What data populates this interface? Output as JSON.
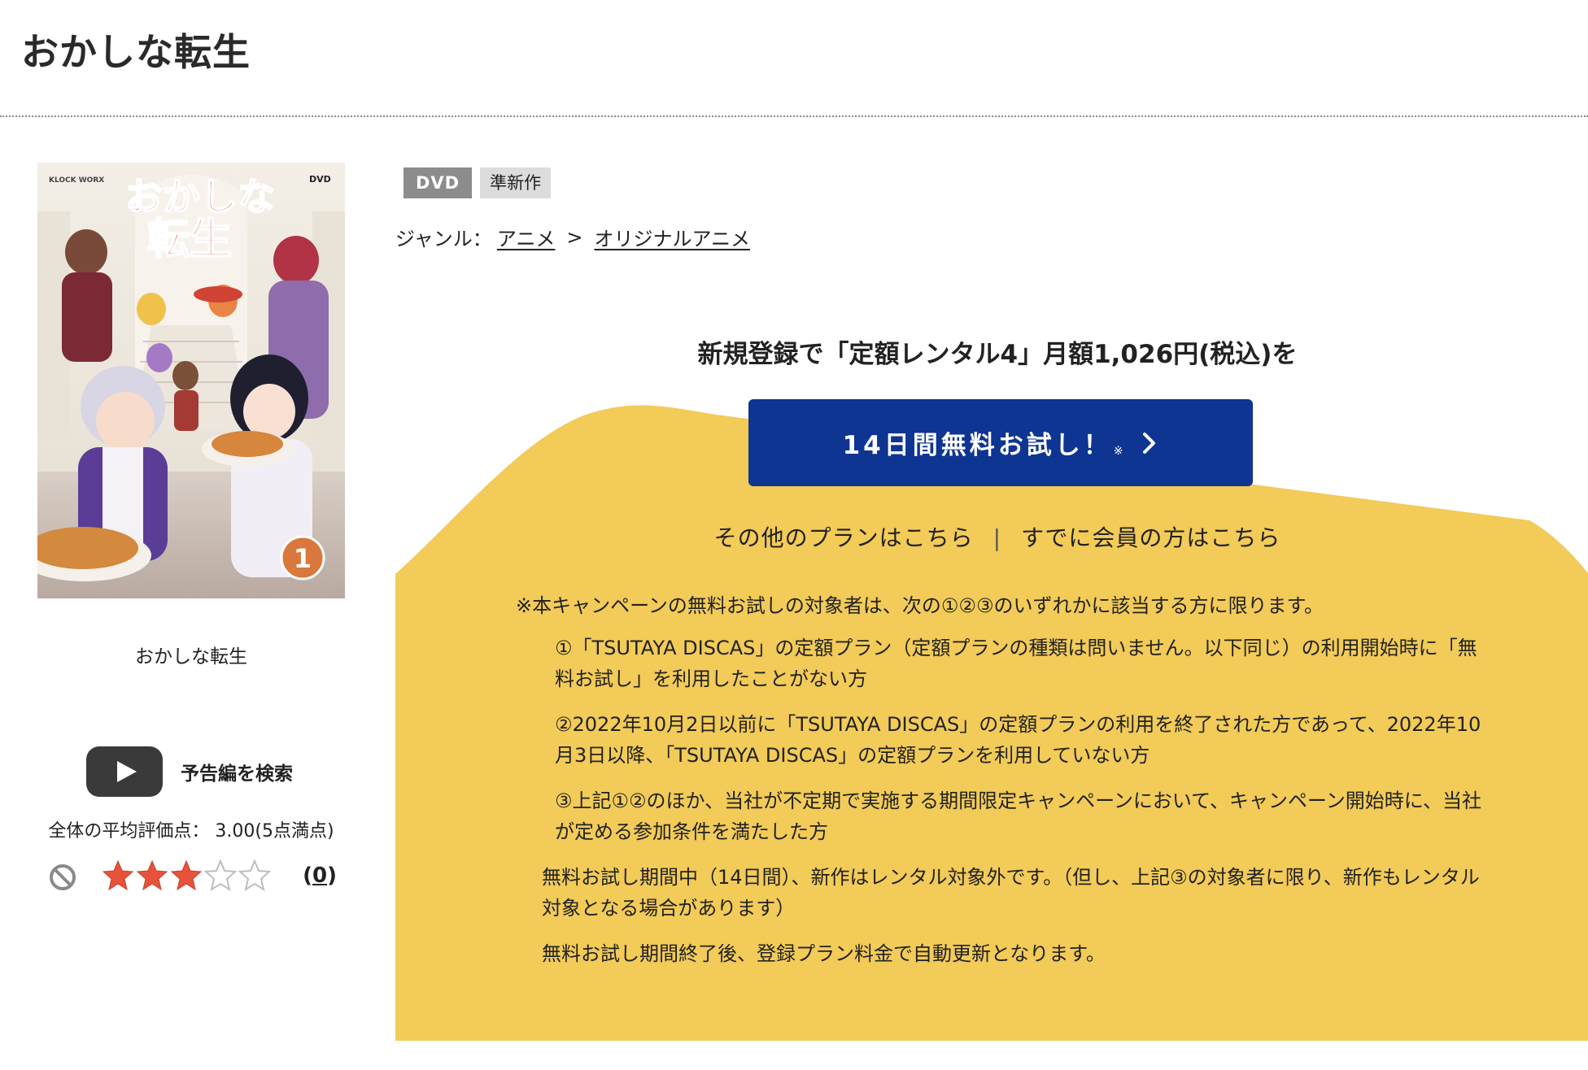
{
  "page": {
    "title": "おかしな転生"
  },
  "cover": {
    "alt": "おかしな転生",
    "caption": "おかしな転生",
    "art_title_line1": "おかしな",
    "art_title_line2": "転生",
    "volume_badge": "1",
    "publisher_mark": "KLOCK WORX",
    "format_mark": "DVD"
  },
  "trailer": {
    "label": "予告編を検索",
    "icon": "play-button-icon"
  },
  "rating": {
    "average_text": "全体の平均評価点：  3.00(5点満点)",
    "stars_filled": 3,
    "stars_total": 5,
    "review_count_open": "(",
    "review_count": "0",
    "review_count_close": ")",
    "star_color": "#e8513a"
  },
  "badges": {
    "format": "DVD",
    "status": "準新作"
  },
  "genre": {
    "label": "ジャンル：",
    "parent": "アニメ",
    "separator": ">",
    "child": "オリジナルアニメ"
  },
  "promo": {
    "headline": "新規登録で「定額レンタル4」月額1,026円(税込)を",
    "cta_label": "14日間無料お試し！",
    "cta_note": "※",
    "cta_color": "#0f3592",
    "bg_color": "#f2cb58",
    "other_plans": "その他のプランはこちら",
    "divider": "|",
    "members": "すでに会員の方はこちら"
  },
  "terms": {
    "intro": "※本キャンペーンの無料お試しの対象者は、次の①②③のいずれかに該当する方に限ります。",
    "cond1": "①「TSUTAYA DISCAS」の定額プラン（定額プランの種類は問いません。以下同じ）の利用開始時に「無料お試し」を利用したことがない方",
    "cond2": "②2022年10月2日以前に「TSUTAYA DISCAS」の定額プランの利用を終了された方であって、2022年10月3日以降、「TSUTAYA DISCAS」の定額プランを利用していない方",
    "cond3": "③上記①②のほか、当社が不定期で実施する期間限定キャンペーンにおいて、キャンペーン開始時に、当社が定める参加条件を満たした方",
    "note1": "無料お試し期間中（14日間）、新作はレンタル対象外です。（但し、上記③の対象者に限り、新作もレンタル対象となる場合があります）",
    "note2": "無料お試し期間終了後、登録プラン料金で自動更新となります。"
  }
}
